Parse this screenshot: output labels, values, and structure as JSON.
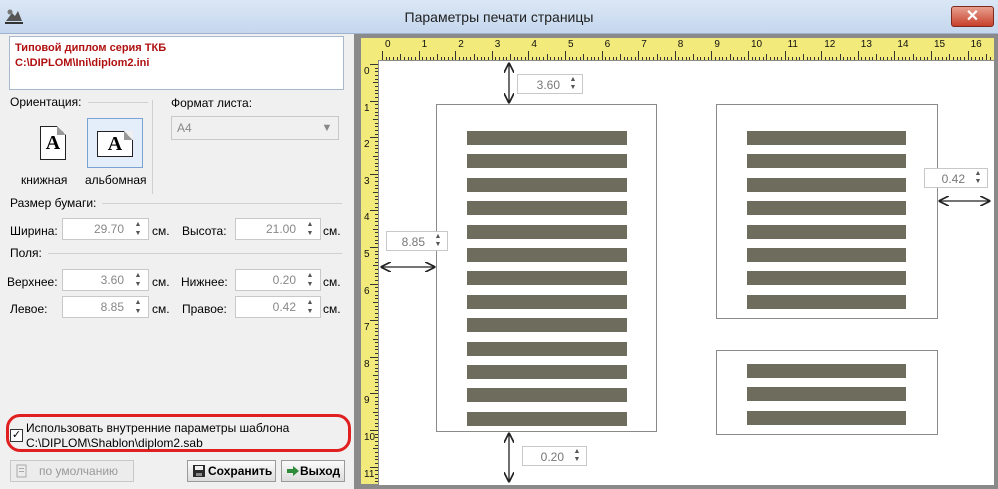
{
  "window": {
    "title": "Параметры печати страницы",
    "close_label": "✕"
  },
  "header": {
    "line1": "Типовой диплом серия ТКБ",
    "line2": "C:\\DIPLOM\\Ini\\diplom2.ini"
  },
  "orientation": {
    "label": "Ориентация:",
    "portrait_label": "книжная",
    "landscape_label": "альбомная",
    "selected": "landscape",
    "icon_letter": "A"
  },
  "format": {
    "label": "Формат листа:",
    "value": "A4"
  },
  "paper_size": {
    "label": "Размер бумаги:",
    "width_label": "Ширина:",
    "width_value": "29.70",
    "height_label": "Высота:",
    "height_value": "21.00",
    "unit": "см."
  },
  "margins": {
    "label": "Поля:",
    "top_label": "Верхнее:",
    "top_value": "3.60",
    "bottom_label": "Нижнее:",
    "bottom_value": "0.20",
    "left_label": "Левое:",
    "left_value": "8.85",
    "right_label": "Правое:",
    "right_value": "0.42",
    "unit": "см."
  },
  "template": {
    "checked": true,
    "check_mark": "✓",
    "line1": "Использовать внутренние параметры шаблона",
    "line2": "C:\\DIPLOM\\Shablon\\diplom2.sab"
  },
  "buttons": {
    "default_label": "по умолчанию",
    "save_label": "Сохранить",
    "exit_label": "Выход"
  },
  "preview": {
    "ruler_h": [
      "0",
      "1",
      "2",
      "3",
      "4",
      "5",
      "6",
      "7",
      "8",
      "9",
      "10",
      "11",
      "12",
      "13",
      "14",
      "15",
      "16"
    ],
    "ruler_v": [
      "0",
      "1",
      "2",
      "3",
      "4",
      "5",
      "6",
      "7",
      "8",
      "9",
      "10",
      "11"
    ],
    "top_value": "3.60",
    "left_value": "8.85",
    "right_value": "0.42",
    "bottom_value": "0.20"
  },
  "colors": {
    "accent_red": "#e02020",
    "header_text": "#b01010",
    "ruler": "#f2ea7a",
    "bar": "#6e6c5c"
  }
}
